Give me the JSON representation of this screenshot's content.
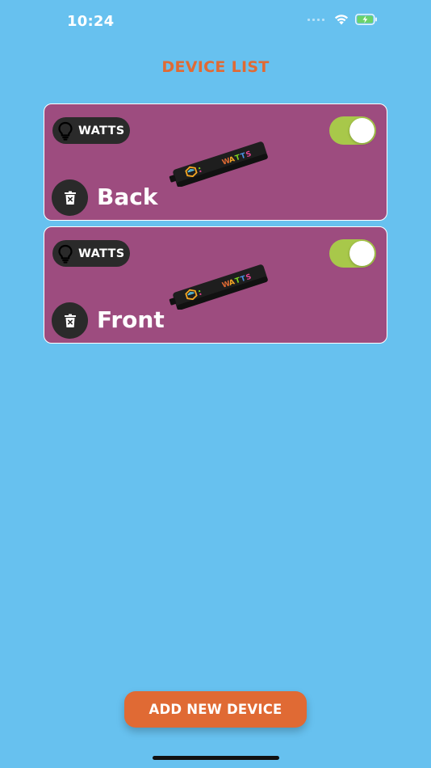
{
  "status_bar": {
    "time": "10:24",
    "icons": [
      "signal-icon",
      "wifi-icon",
      "battery-charging-icon"
    ]
  },
  "header": {
    "title": "DEVICE LIST"
  },
  "devices": [
    {
      "brand": "WATTS",
      "name": "Back",
      "enabled": true,
      "icons": [
        "bulb-icon",
        "trash-icon"
      ]
    },
    {
      "brand": "WATTS",
      "name": "Front",
      "enabled": true,
      "icons": [
        "bulb-icon",
        "trash-icon"
      ]
    }
  ],
  "footer": {
    "add_button_label": "ADD NEW DEVICE"
  },
  "colors": {
    "background": "#67c1ef",
    "card": "#9d4c7f",
    "accent": "#e06a34",
    "toggle_on": "#a8c84a",
    "dark": "#2a2a2a"
  }
}
